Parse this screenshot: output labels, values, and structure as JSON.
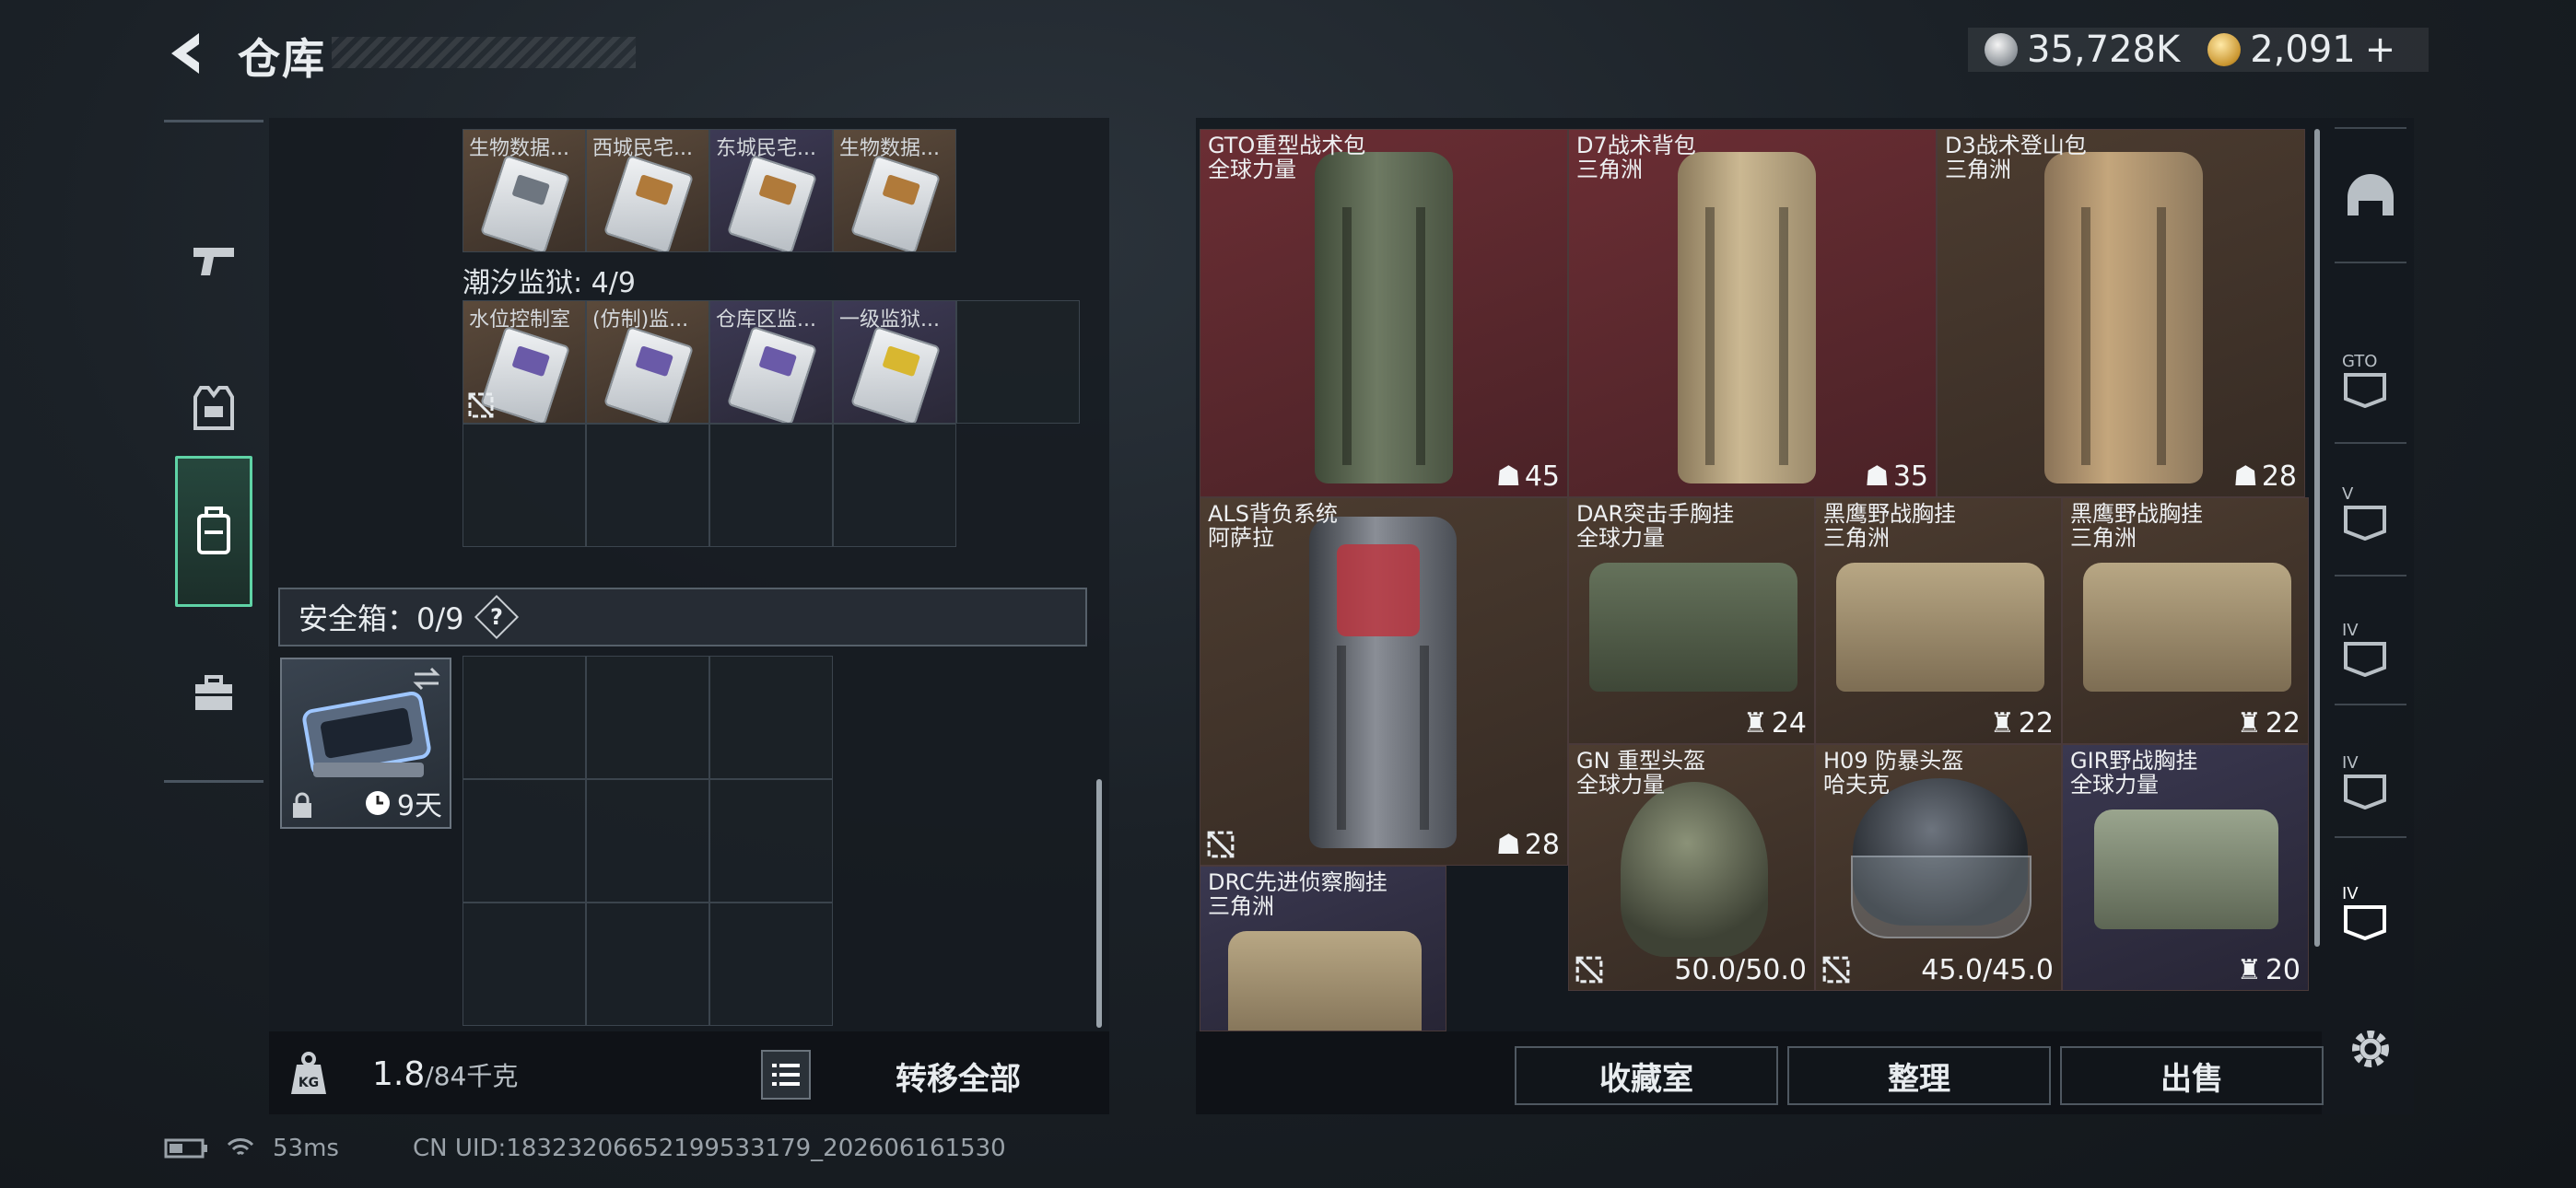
{
  "header": {
    "title": "仓库",
    "currency_silver": "35,728K",
    "currency_gold": "2,091",
    "currency_add": "+"
  },
  "categories": [
    {
      "name": "weapons",
      "icon": "pistol-icon"
    },
    {
      "name": "gear",
      "icon": "helmet-icon"
    },
    {
      "name": "backpack",
      "icon": "backpack-icon",
      "active": true
    },
    {
      "name": "supplies",
      "icon": "toolbox-icon"
    }
  ],
  "inventory": {
    "top_cards": [
      "生物数据...",
      "西城民宅...",
      "东城民宅...",
      "生物数据..."
    ],
    "prison_label": "潮汐监狱: 4/9",
    "prison_cards": [
      "水位控制室",
      "(仿制)监...",
      "仓库区监...",
      "一级监狱..."
    ],
    "safe_label": "安全箱：0/9",
    "safe_help": "?",
    "safe_box_days": "9天",
    "weight_value": "1.8",
    "weight_max": "/84千克",
    "transfer_label": "转移全部"
  },
  "items": [
    {
      "name": "GTO重型战术包",
      "brand": "全球力量",
      "qty": "45"
    },
    {
      "name": "D7战术背包",
      "brand": "三角洲",
      "qty": "35"
    },
    {
      "name": "D3战术登山包",
      "brand": "三角洲",
      "qty": "28"
    },
    {
      "name": "ALS背负系统",
      "brand": "阿萨拉",
      "qty": "28"
    },
    {
      "name": "DAR突击手胸挂",
      "brand": "全球力量",
      "qty": "24"
    },
    {
      "name": "黑鹰野战胸挂",
      "brand": "三角洲",
      "qty": "22"
    },
    {
      "name": "黑鹰野战胸挂",
      "brand": "三角洲",
      "qty": "22"
    },
    {
      "name": "GN 重型头盔",
      "brand": "全球力量",
      "durability": "50.0/50.0"
    },
    {
      "name": "H09 防暴头盔",
      "brand": "哈夫克",
      "durability": "45.0/45.0"
    },
    {
      "name": "GIR野战胸挂",
      "brand": "全球力量",
      "qty": "20"
    },
    {
      "name": "DRC先进侦察胸挂",
      "brand": "三角洲"
    }
  ],
  "actions": {
    "collection": "收藏室",
    "organize": "整理",
    "sell": "出售"
  },
  "filters": [
    "GTO",
    "V",
    "IV",
    "IV",
    "IV"
  ],
  "status": {
    "ping": "53ms",
    "uid": "CN UID:18323206652199533179_202606161530"
  },
  "colors": {
    "accent": "#5fd3a6",
    "red_rarity": "#6b2e34",
    "gold_rarity": "#4c3c30",
    "purple_rarity": "#3a3850"
  }
}
